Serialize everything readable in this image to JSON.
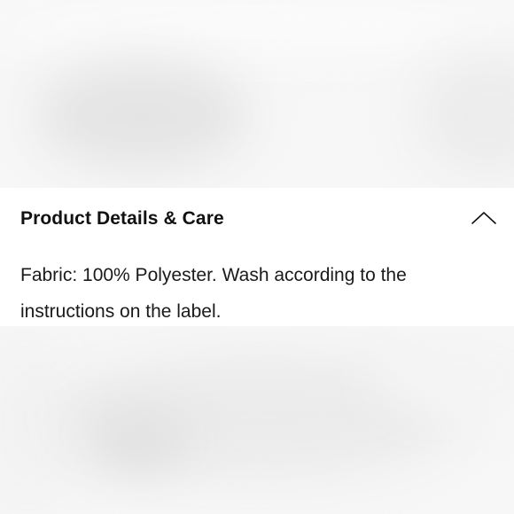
{
  "accordion": {
    "title": "Product Details & Care",
    "expanded": true,
    "toggle_icon": "chevron-up-icon",
    "body_lines": [
      "Fabric: 100% Polyester. Wash according to the",
      "instructions on the label."
    ]
  },
  "colors": {
    "panel_background": "#ffffff",
    "text": "#111111",
    "backdrop": "#f7f7f7"
  }
}
